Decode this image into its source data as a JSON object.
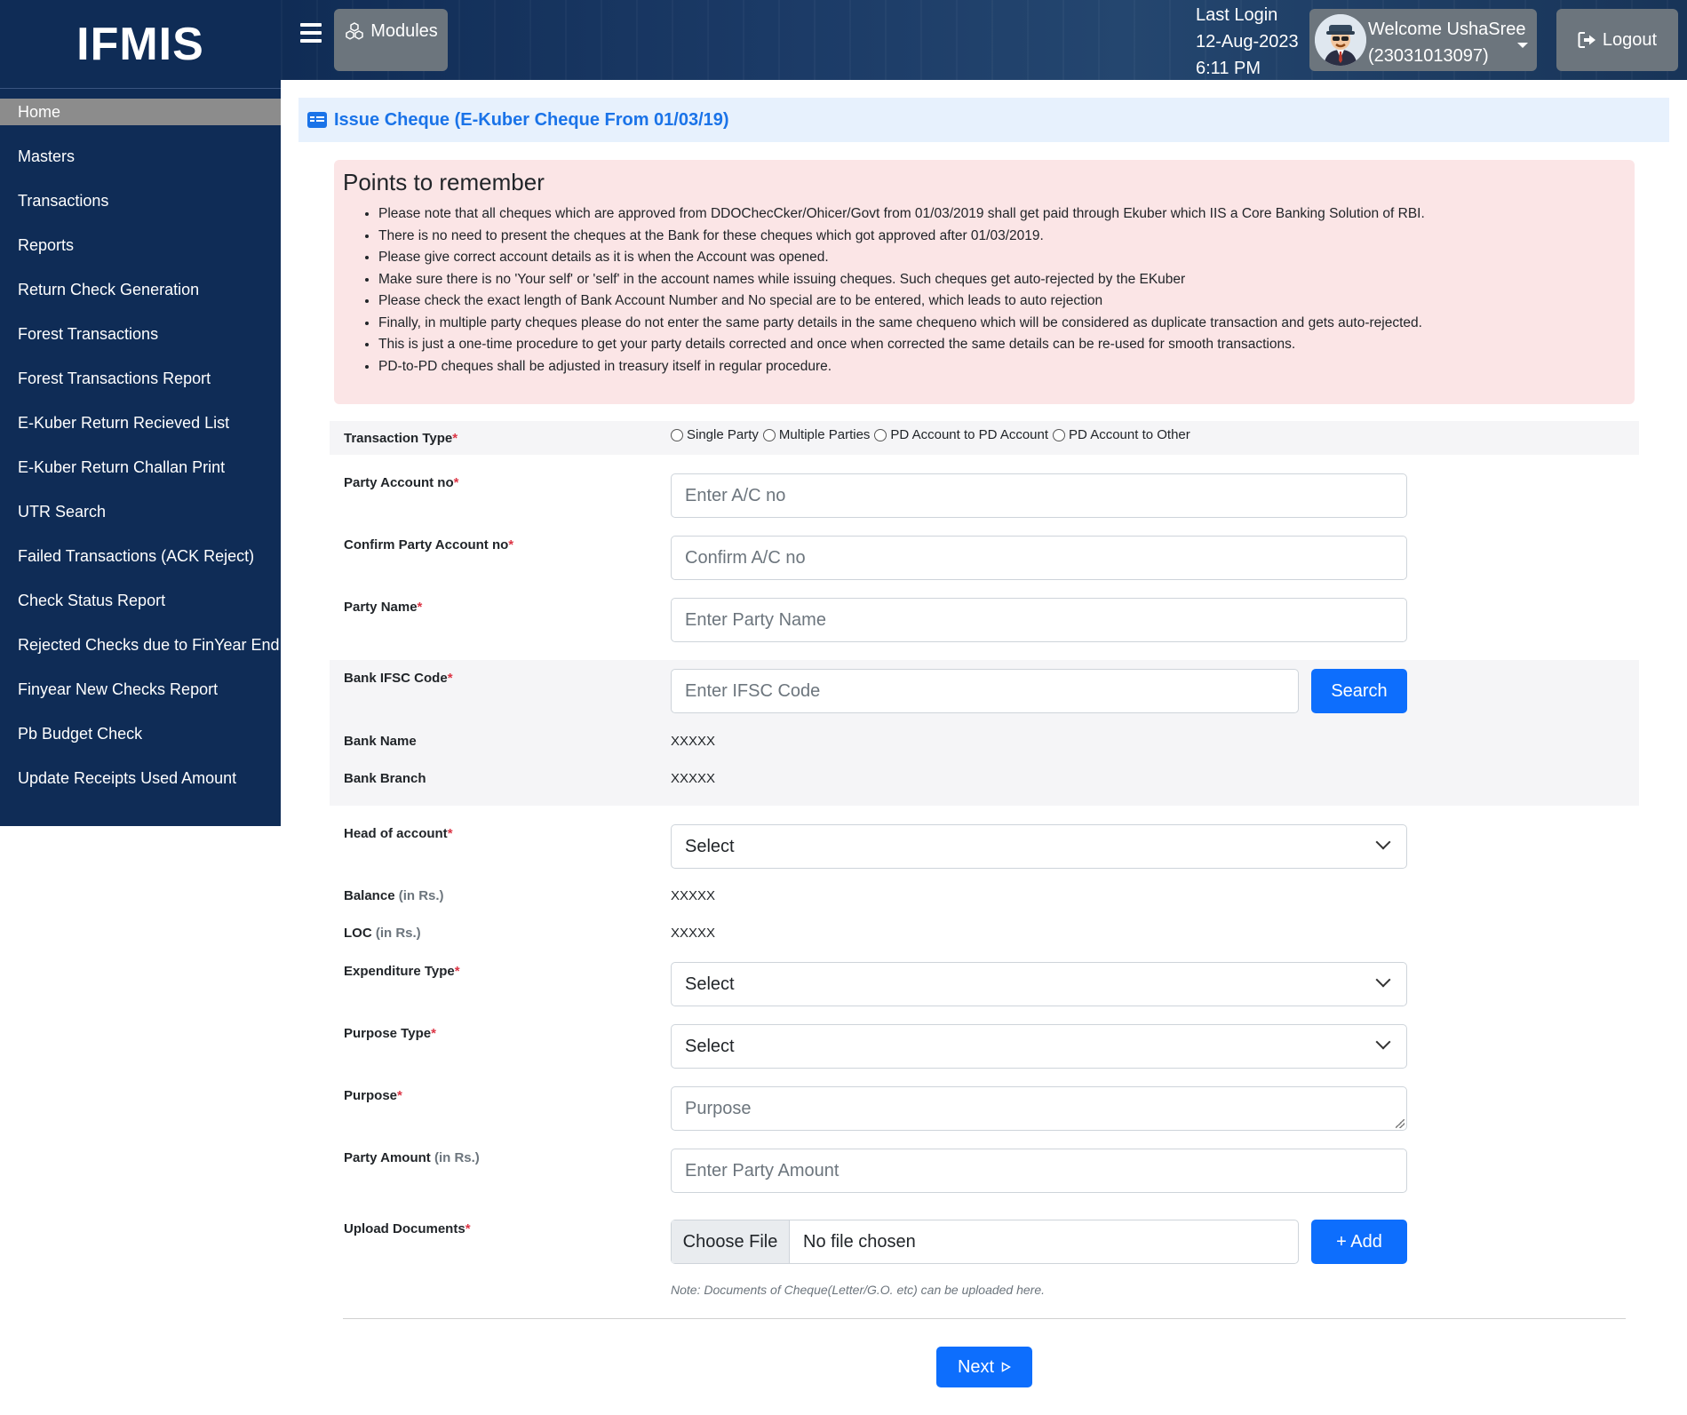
{
  "brand": "IFMIS",
  "sidebar": {
    "items": [
      {
        "label": "Home"
      },
      {
        "label": "Masters"
      },
      {
        "label": "Transactions"
      },
      {
        "label": "Reports"
      },
      {
        "label": "Return Check Generation"
      },
      {
        "label": "Forest Transactions"
      },
      {
        "label": "Forest Transactions Report"
      },
      {
        "label": "E-Kuber Return Recieved List"
      },
      {
        "label": "E-Kuber Return Challan Print"
      },
      {
        "label": "UTR Search"
      },
      {
        "label": "Failed Transactions (ACK Reject)"
      },
      {
        "label": "Check Status Report"
      },
      {
        "label": "Rejected Checks due to FinYear End"
      },
      {
        "label": "Finyear New Checks Report"
      },
      {
        "label": "Pb Budget Check"
      },
      {
        "label": "Update Receipts Used Amount"
      }
    ]
  },
  "header": {
    "modules_label": "Modules",
    "last_login_label": "Last Login",
    "last_login_date": "12-Aug-2023",
    "last_login_time": "6:11 PM",
    "welcome": "Welcome UshaSree",
    "user_id": "(23031013097)",
    "logout_label": "Logout"
  },
  "page": {
    "title": "Issue Cheque (E-Kuber Cheque From 01/03/19)"
  },
  "points": {
    "heading": "Points to remember",
    "items": [
      "Please note that all cheques which are approved from DDOChecCker/Ohicer/Govt from 01/03/2019 shall get paid through Ekuber which IIS a Core Banking Solution of RBI.",
      "There is no need to present the cheques at the Bank for these cheques which got approved after 01/03/2019.",
      "Please give correct account details as it is when the Account was opened.",
      "Make sure there is no 'Your self' or 'self' in the account names while issuing cheques. Such cheques get auto-rejected by the EKuber",
      "Please check the exact length of Bank Account Number and No special are to be entered, which leads to auto rejection",
      "Finally, in multiple party cheques please do not enter the same party details in the same chequeno which will be considered as duplicate transaction and gets auto-rejected.",
      "This is just a one-time procedure to get your party details corrected and once when corrected the same details can be re-used for smooth transactions.",
      "PD-to-PD cheques shall be adjusted in treasury itself in regular procedure."
    ]
  },
  "form": {
    "transaction_type": {
      "label": "Transaction Type",
      "options": [
        "Single Party",
        "Multiple Parties",
        "PD Account to PD Account",
        "PD Account to Other"
      ]
    },
    "party_account": {
      "label": "Party Account no",
      "placeholder": "Enter A/C no"
    },
    "confirm_account": {
      "label": "Confirm Party Account no",
      "placeholder": "Confirm A/C no"
    },
    "party_name": {
      "label": "Party Name",
      "placeholder": "Enter Party Name"
    },
    "ifsc": {
      "label": "Bank IFSC Code",
      "placeholder": "Enter IFSC Code",
      "search_label": "Search"
    },
    "bank_name": {
      "label": "Bank Name",
      "value": "XXXXX"
    },
    "bank_branch": {
      "label": "Bank Branch",
      "value": "XXXXX"
    },
    "head_of_account": {
      "label": "Head of account",
      "value": "Select"
    },
    "balance": {
      "label": "Balance",
      "unit": "(in Rs.)",
      "value": "XXXXX"
    },
    "loc": {
      "label": "LOC",
      "unit": "(in Rs.)",
      "value": "XXXXX"
    },
    "expenditure_type": {
      "label": "Expenditure Type",
      "value": "Select"
    },
    "purpose_type": {
      "label": "Purpose Type",
      "value": "Select"
    },
    "purpose": {
      "label": "Purpose",
      "placeholder": "Purpose"
    },
    "party_amount": {
      "label": "Party Amount",
      "unit": "(in Rs.)",
      "placeholder": "Enter Party Amount"
    },
    "upload": {
      "label": "Upload Documents",
      "choose_label": "Choose File",
      "status": "No file chosen",
      "add_label": "+ Add",
      "note": "Note: Documents of Cheque(Letter/G.O. etc) can be uploaded here."
    },
    "next_label": "Next"
  },
  "colors": {
    "sidebar_bg": "#0f2c56",
    "primary": "#0d6efd",
    "title_blue": "#1a73e8",
    "alert_bg": "#fbe5e6",
    "required": "#dc3545"
  }
}
